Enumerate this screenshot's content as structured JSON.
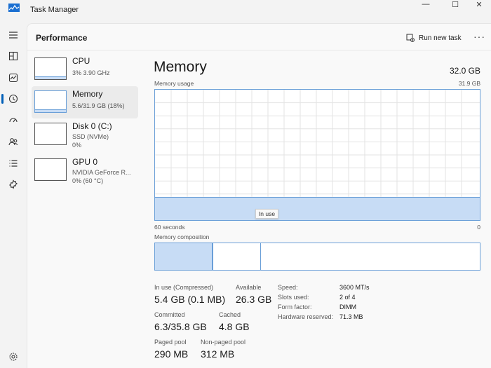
{
  "app": {
    "title": "Task Manager",
    "page_title": "Performance",
    "run_new_task_label": "Run new task",
    "more_label": "···"
  },
  "window_controls": {
    "minimize": "—",
    "maximize": "☐",
    "close": "✕"
  },
  "rail_icons": [
    "hamburger-icon",
    "processes-icon",
    "performance-icon",
    "app-history-icon",
    "startup-apps-icon",
    "users-icon",
    "details-icon",
    "services-icon",
    "settings-icon"
  ],
  "side_items": [
    {
      "name": "CPU",
      "sub1": "3% 3.90 GHz",
      "sub2": "",
      "usage": 0.03
    },
    {
      "name": "Memory",
      "sub1": "5.6/31.9 GB (18%)",
      "sub2": "",
      "usage": 0.18
    },
    {
      "name": "Disk 0 (C:)",
      "sub1": "SSD (NVMe)",
      "sub2": "0%",
      "usage": 0.0
    },
    {
      "name": "GPU 0",
      "sub1": "NVIDIA GeForce R...",
      "sub2": "0% (60 °C)",
      "usage": 0.0
    }
  ],
  "memory": {
    "title": "Memory",
    "total": "32.0 GB",
    "usage_label": "Memory usage",
    "usage_max": "31.9 GB",
    "usage_fraction": 0.18,
    "axis_left": "60 seconds",
    "axis_right": "0",
    "tooltip": "In use",
    "composition_label": "Memory composition",
    "composition_inuse_fraction": 0.18,
    "stats": {
      "inuse_label": "In use (Compressed)",
      "inuse_value": "5.4 GB (0.1 MB)",
      "available_label": "Available",
      "available_value": "26.3 GB",
      "committed_label": "Committed",
      "committed_value": "6.3/35.8 GB",
      "cached_label": "Cached",
      "cached_value": "4.8 GB",
      "paged_label": "Paged pool",
      "paged_value": "290 MB",
      "nonpaged_label": "Non-paged pool",
      "nonpaged_value": "312 MB"
    },
    "props": {
      "speed_label": "Speed:",
      "speed_value": "3600 MT/s",
      "slots_label": "Slots used:",
      "slots_value": "2 of 4",
      "form_label": "Form factor:",
      "form_value": "DIMM",
      "reserved_label": "Hardware reserved:",
      "reserved_value": "71.3 MB"
    }
  },
  "colors": {
    "accent": "#005fb8",
    "graph_line": "#6a9fd8",
    "graph_fill": "#c7dcf5"
  }
}
